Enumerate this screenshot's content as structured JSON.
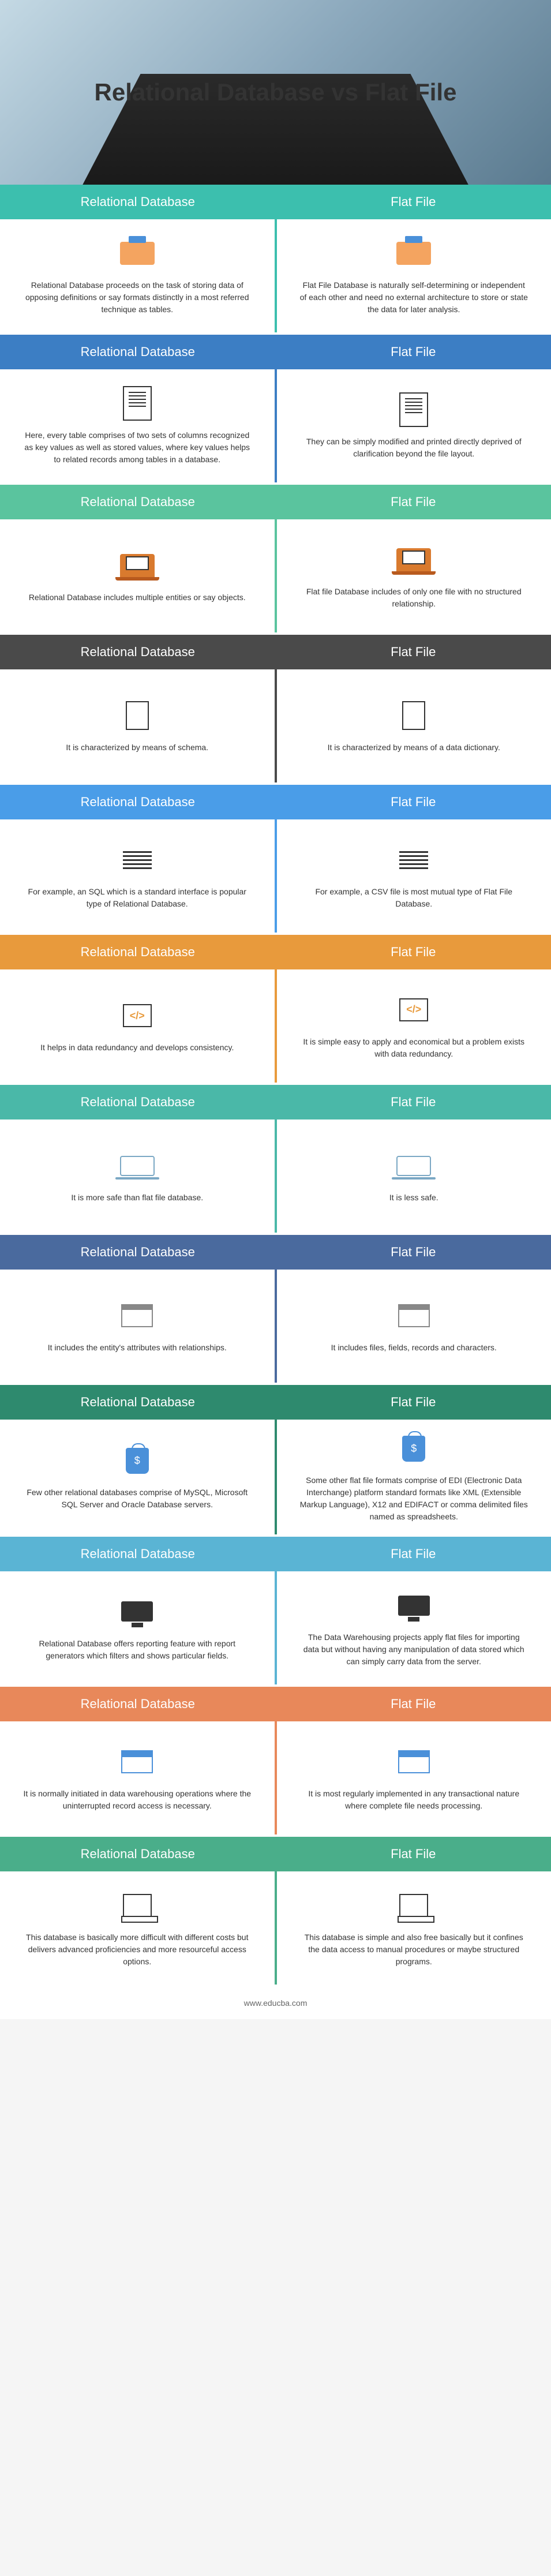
{
  "title": "Relational Database vs Flat File",
  "leftLabel": "Relational Database",
  "rightLabel": "Flat File",
  "footer": "www.educba.com",
  "rows": [
    {
      "color": "c-teal",
      "left": "Relational Database proceeds on the task of storing data of opposing definitions or say formats distinctly in a most referred technique as tables.",
      "right": "Flat File Database is naturally self-determining or independent of each other and need no external architecture to store or state the data for later analysis.",
      "iconL": "desk",
      "iconR": "desk"
    },
    {
      "color": "c-blue",
      "left": "Here, every table comprises of two sets of columns recognized as key values as well as stored values, where key values helps to related records among tables in a database.",
      "right": "They can be simply modified and printed directly deprived of clarification beyond the file layout.",
      "iconL": "doc",
      "iconR": "doc"
    },
    {
      "color": "c-green",
      "left": "Relational Database includes multiple entities or say objects.",
      "right": "Flat file Database includes of only one file with no structured relationship.",
      "iconL": "laptop",
      "iconR": "laptop"
    },
    {
      "color": "c-dark",
      "left": "It is characterized by means of schema.",
      "right": "It is characterized by means of a data dictionary.",
      "iconL": "page",
      "iconR": "page"
    },
    {
      "color": "c-brightblue",
      "left": "For example, an SQL which is a standard interface is popular type of Relational Database.",
      "right": "For example, a CSV file is most mutual type of Flat File Database.",
      "iconL": "lines",
      "iconR": "lines"
    },
    {
      "color": "c-orange",
      "left": "It helps in data redundancy and develops consistency.",
      "right": "It is simple easy to apply and economical but a problem exists with data redundancy.",
      "iconL": "code",
      "iconR": "code"
    },
    {
      "color": "c-teal2",
      "left": "It is more safe than flat file database.",
      "right": "It is less safe.",
      "iconL": "laptop-open",
      "iconR": "laptop-open"
    },
    {
      "color": "c-navy",
      "left": "It includes the entity's attributes with relationships.",
      "right": "It includes files, fields, records and characters.",
      "iconL": "window",
      "iconR": "window"
    },
    {
      "color": "c-darkgreen",
      "left": "Few other relational databases comprise of MySQL, Microsoft SQL Server and Oracle Database servers.",
      "right": "Some other flat file formats comprise of EDI (Electronic Data Interchange) platform standard formats like XML (Extensible Markup Language), X12 and EDIFACT or comma delimited files named as spreadsheets.",
      "iconL": "money",
      "iconR": "money"
    },
    {
      "color": "c-skyblue",
      "left": "Relational Database offers reporting feature with report generators which filters and shows particular fields.",
      "right": "The Data Warehousing projects apply flat files for importing data but without having any manipulation of data stored which can simply carry data from the server.",
      "iconL": "monitor",
      "iconR": "monitor"
    },
    {
      "color": "c-coral",
      "left": "It is normally initiated in data warehousing operations where the uninterrupted record access is necessary.",
      "right": "It is most regularly implemented in any transactional nature where complete file needs processing.",
      "iconL": "browser",
      "iconR": "browser"
    },
    {
      "color": "c-green2",
      "left": "This database is basically more difficult with different costs but delivers advanced proficiencies and more resourceful access options.",
      "right": "This database is simple and also free basically but it confines the data access to manual procedures or maybe structured programs.",
      "iconL": "computer",
      "iconR": "computer"
    }
  ]
}
